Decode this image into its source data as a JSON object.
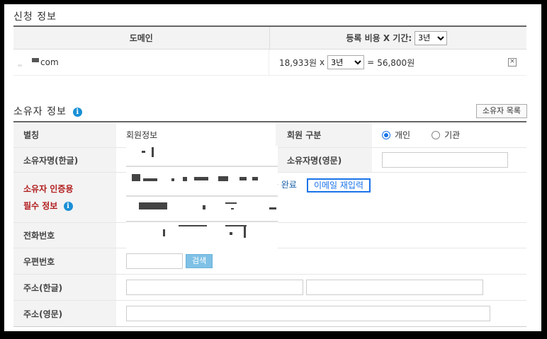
{
  "application_section": {
    "title": "신청 정보",
    "table": {
      "col_domain": "도메인",
      "col_fee": "등록 비용 X 기간:",
      "period_select": "3년",
      "row": {
        "domain_suffix": "com",
        "unit_price": "18,933원",
        "multiply": "x",
        "period_select": "3년",
        "equals": "=",
        "total": "56,800원",
        "remove_icon": "x-icon"
      }
    }
  },
  "owner_section": {
    "title": "소유자 정보",
    "info_icon": "i",
    "owner_list_button": "소유자 목록",
    "rows": {
      "nickname_label": "별칭",
      "nickname_value": "회원정보",
      "member_type_label": "회원 구분",
      "member_type_individual": "개인",
      "member_type_org": "기관",
      "member_type_selected": "개인",
      "name_kr_label": "소유자명(한글)",
      "name_en_label": "소유자명(영문)",
      "auth_label_line1": "소유자 인증용",
      "auth_label_line2": "필수 정보",
      "auth_status": "증 완료",
      "email_reenter_button": "이메일 재입력",
      "phone_label": "전화번호",
      "postal_label": "우편번호",
      "search_button": "검색",
      "address_kr_label": "주소(한글)",
      "address_en_label": "주소(영문)"
    }
  },
  "colors": {
    "accent": "#1a73e8",
    "required_label": "#b21d1d",
    "search_button": "#7fc1e6"
  }
}
